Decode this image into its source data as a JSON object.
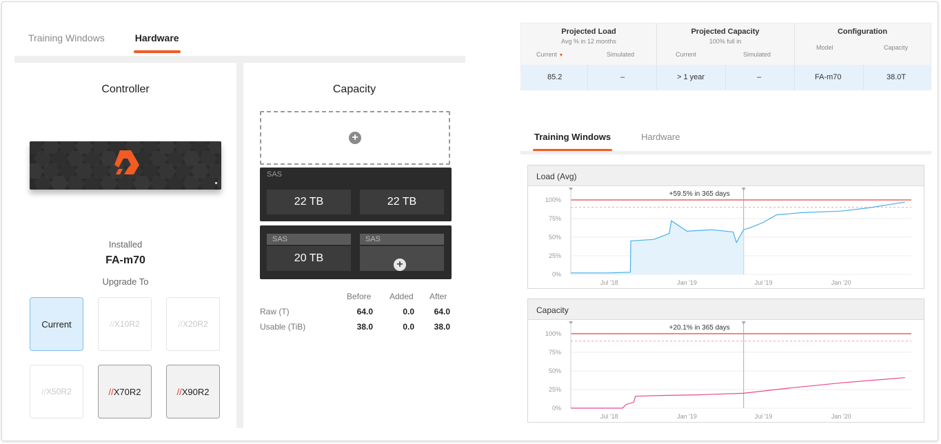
{
  "left_tabs": [
    {
      "label": "Training Windows",
      "active": false
    },
    {
      "label": "Hardware",
      "active": true
    }
  ],
  "controller": {
    "title": "Controller",
    "installed_label": "Installed",
    "installed_model": "FA-m70",
    "upgrade_label": "Upgrade To",
    "options": [
      {
        "prefix": "",
        "name": "Current",
        "state": "current"
      },
      {
        "prefix": "//",
        "name": "X10R2",
        "state": "disabled"
      },
      {
        "prefix": "//",
        "name": "X20R2",
        "state": "disabled"
      },
      {
        "prefix": "//",
        "name": "X50R2",
        "state": "disabled"
      },
      {
        "prefix": "//",
        "name": "X70R2",
        "state": "enabled"
      },
      {
        "prefix": "//",
        "name": "X90R2",
        "state": "enabled"
      }
    ]
  },
  "capacity": {
    "title": "Capacity",
    "shelf1": {
      "label": "SAS",
      "drives": [
        "22 TB",
        "22 TB"
      ]
    },
    "shelf2": {
      "drives": [
        {
          "label": "SAS",
          "value": "20 TB"
        },
        {
          "label": "SAS"
        }
      ]
    },
    "stats": {
      "headers": [
        "Before",
        "Added",
        "After"
      ],
      "rows": [
        {
          "label": "Raw (T)",
          "values": [
            "64.0",
            "0.0",
            "64.0"
          ]
        },
        {
          "label": "Usable (TiB)",
          "values": [
            "38.0",
            "0.0",
            "38.0"
          ]
        }
      ]
    }
  },
  "summary": {
    "projected_load": {
      "title": "Projected Load",
      "subtitle": "Avg % in 12 months",
      "current_hdr": "Current",
      "simulated_hdr": "Simulated",
      "current": "85.2",
      "simulated": "–"
    },
    "projected_capacity": {
      "title": "Projected Capacity",
      "subtitle": "100% full in",
      "current_hdr": "Current",
      "simulated_hdr": "Simulated",
      "current": "> 1 year",
      "simulated": "–"
    },
    "configuration": {
      "title": "Configuration",
      "model_hdr": "Model",
      "capacity_hdr": "Capacity",
      "model": "FA-m70",
      "capacity": "38.0T"
    }
  },
  "right_tabs": [
    {
      "label": "Training Windows",
      "active": true
    },
    {
      "label": "Hardware",
      "active": false
    }
  ],
  "colors": {
    "accent": "#f25b22",
    "load_line": "#4ab0e8",
    "capacity_line": "#e8488c",
    "threshold": "#e84040"
  },
  "chart_data": [
    {
      "type": "line",
      "title": "Load (Avg)",
      "annotation": "+59.5% in 365 days",
      "y_ticks": [
        "100%",
        "75%",
        "50%",
        "25%",
        "0%"
      ],
      "x_ticks": [
        "Jul '18",
        "Jan '19",
        "Jul '19",
        "Jan '20"
      ],
      "ylim": [
        0,
        100
      ],
      "threshold": 100,
      "warning": 90,
      "split_date": "2019-05-15",
      "series": [
        {
          "x": [
            "2018-04-01",
            "2018-07-01",
            "2018-08-20",
            "2018-08-21",
            "2018-10-15",
            "2018-11-20",
            "2018-11-25",
            "2019-01-01",
            "2019-03-01",
            "2019-04-20",
            "2019-04-28",
            "2019-05-15",
            "2019-06-01",
            "2019-07-01",
            "2019-08-01",
            "2019-10-01",
            "2020-01-01",
            "2020-03-01",
            "2020-05-31"
          ],
          "y": [
            2,
            2,
            3,
            45,
            47,
            55,
            72,
            58,
            60,
            57,
            43,
            60,
            63,
            70,
            80,
            83,
            85,
            89,
            97
          ]
        }
      ]
    },
    {
      "type": "line",
      "title": "Capacity",
      "annotation": "+20.1% in 365 days",
      "y_ticks": [
        "100%",
        "75%",
        "50%",
        "25%",
        "0%"
      ],
      "x_ticks": [
        "Jul '18",
        "Jan '19",
        "Jul '19",
        "Jan '20"
      ],
      "ylim": [
        0,
        100
      ],
      "threshold": 100,
      "warning": 90,
      "split_date": "2019-05-15",
      "series": [
        {
          "x": [
            "2018-04-01",
            "2018-08-01",
            "2018-08-10",
            "2018-08-28",
            "2018-09-01",
            "2018-11-01",
            "2019-02-01",
            "2019-05-15",
            "2019-09-01",
            "2020-01-01",
            "2020-05-31"
          ],
          "y": [
            0,
            0,
            5,
            8,
            16,
            17,
            18,
            20,
            27,
            34,
            41
          ]
        }
      ]
    }
  ]
}
